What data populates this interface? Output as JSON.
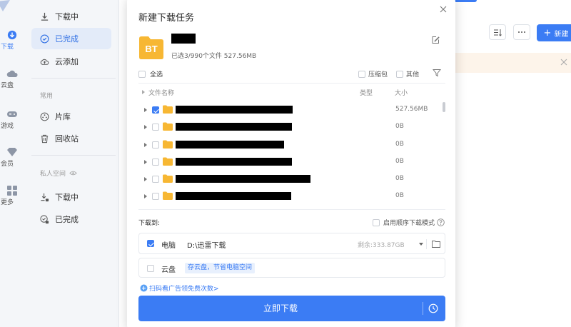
{
  "rail": {
    "items": [
      {
        "label": "下载",
        "icon": "download-icon",
        "active": true
      },
      {
        "label": "云盘",
        "icon": "cloud-icon"
      },
      {
        "label": "游戏",
        "icon": "gamepad-icon"
      },
      {
        "label": "会员",
        "icon": "diamond-icon"
      },
      {
        "label": "更多",
        "icon": "grid-icon"
      }
    ]
  },
  "nav": {
    "items": [
      {
        "label": "下载中",
        "icon": "download-icon"
      },
      {
        "label": "已完成",
        "icon": "check-circle-icon",
        "active": true
      },
      {
        "label": "云添加",
        "icon": "cloud-upload-icon"
      }
    ],
    "common_group": "常用",
    "common_items": [
      {
        "label": "片库",
        "icon": "film-reel-icon"
      },
      {
        "label": "回收站",
        "icon": "trash-icon"
      }
    ],
    "private_group": "私人空间",
    "private_items": [
      {
        "label": "下载中",
        "icon": "lock-download-icon"
      },
      {
        "label": "已完成",
        "icon": "lock-check-icon"
      }
    ]
  },
  "main": {
    "new_button": "新建"
  },
  "dialog": {
    "title": "新建下载任务",
    "bt_label": "BT",
    "summary": "已选3/990个文件 527.56MB",
    "select_all": "全选",
    "filter_compressed": "压缩包",
    "filter_other": "其他",
    "columns": {
      "name": "文件名称",
      "type": "类型",
      "size": "大小"
    },
    "files": [
      {
        "checked": true,
        "size": "527.56MB"
      },
      {
        "checked": false,
        "size": "0B"
      },
      {
        "checked": false,
        "size": "0B"
      },
      {
        "checked": false,
        "size": "0B"
      },
      {
        "checked": false,
        "size": "0B"
      },
      {
        "checked": false,
        "size": "0B"
      }
    ],
    "download_to_label": "下载到:",
    "sequential_label": "启用顺序下载模式",
    "pc_label": "电脑",
    "pc_path": "D:\\迅雷下载",
    "pc_free": "剩余:333.87GB",
    "cloud_label": "云盘",
    "cloud_tag": "存云盘，节省电脑空间",
    "scan_link": "扫码看广告领免费次数>",
    "download_button": "立即下载"
  },
  "colors": {
    "accent": "#3b7cf4",
    "folder": "#f7b733",
    "sidebar_bg": "#f4f6f9",
    "active_nav_bg": "#e3ebf9"
  }
}
